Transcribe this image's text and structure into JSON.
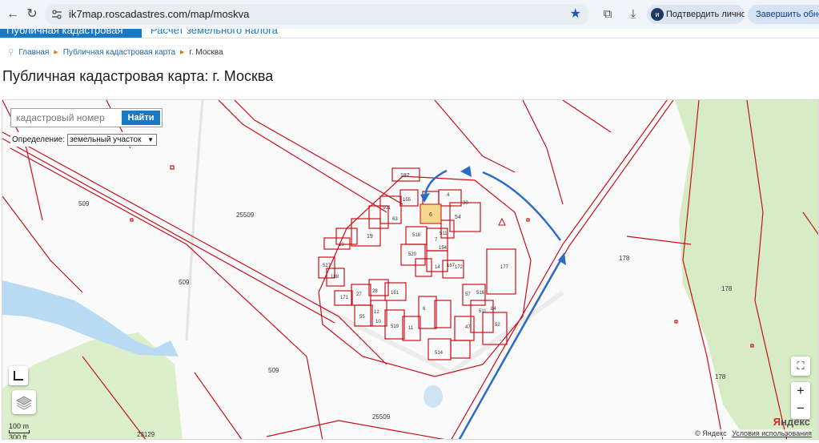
{
  "browser": {
    "url": "ik7map.roscadastres.com/map/moskva",
    "verify_label": "Подтвердить личность",
    "verify_badge": "и",
    "update_label": "Завершить обновление"
  },
  "site": {
    "tab_active": "Публичная кадастровая карта",
    "tab_other": "Расчет земельного налога"
  },
  "breadcrumb": {
    "home": "Главная",
    "map": "Публичная кадастровая карта",
    "current": "г. Москва"
  },
  "page_title": "Публичная кадастровая карта: г. Москва",
  "map": {
    "search_placeholder": "кадастровый номер",
    "search_button": "Найти",
    "definition_label": "Определение:",
    "definition_value": "земельный участок",
    "scale_m": "100 m",
    "scale_ft": "300 ft",
    "copyright": "© Яндекс",
    "terms": "Условия использования",
    "logo_y": "Я",
    "logo_rest": "ндекс",
    "parcel_labels": [
      "509",
      "25509",
      "509",
      "509",
      "25509",
      "23129",
      "178",
      "178",
      "178",
      "187",
      "155",
      "501",
      "63",
      "4",
      "30",
      "54",
      "6",
      "518",
      "511",
      "7",
      "19",
      "10",
      "14",
      "154",
      "520",
      "527",
      "188",
      "167",
      "172",
      "171",
      "27",
      "28",
      "161",
      "55",
      "12",
      "10",
      "519",
      "11",
      "6",
      "514",
      "57",
      "516",
      "47",
      "511",
      "84",
      "52",
      "177"
    ],
    "colors": {
      "parcel": "#c8101a",
      "water": "#b9daf3",
      "forest": "#d7ecc4",
      "arrow": "#2b6cc4",
      "highlight": "#f7d88a"
    }
  }
}
